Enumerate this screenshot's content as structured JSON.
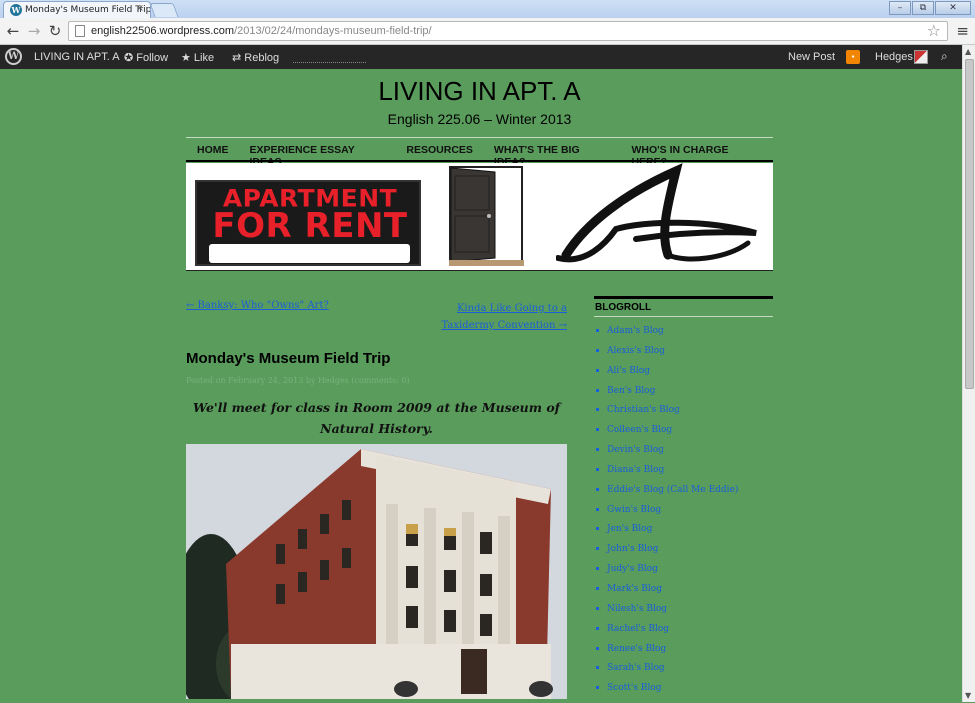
{
  "browser": {
    "tab_title": "Monday's Museum Field Trip",
    "tab_close": "×",
    "url_host": "english22506.wordpress.com",
    "url_path": "/2013/02/24/mondays-museum-field-trip/",
    "window_buttons": [
      "–",
      "⧉",
      "✕"
    ]
  },
  "adminbar": {
    "site_name": "LIVING IN APT. A",
    "follow": "Follow",
    "like": "Like",
    "reblog": "Reblog",
    "new_post": "New Post",
    "user": "Hedges"
  },
  "site": {
    "title": "LIVING IN APT. A",
    "description": "English 225.06 – Winter 2013"
  },
  "nav": [
    "HOME",
    "EXPERIENCE ESSAY IDEAS",
    "RESOURCES",
    "WHAT'S THE BIG IDEA?",
    "WHO'S IN CHARGE HERE?"
  ],
  "banner": {
    "sign_line1": "APARTMENT",
    "sign_line2": "FOR RENT"
  },
  "post_nav": {
    "prev": "← Banksy: Who \"Owns\" Art?",
    "next_line1": "Kinda Like Going to a",
    "next_line2": "Taxidermy Convention →"
  },
  "post": {
    "title": "Monday's Museum Field Trip",
    "meta": "Posted on February 24, 2013 by Hedges (comments: 0)",
    "lead": "We'll meet for class in Room 2009 at the Museum of Natural History."
  },
  "sidebar": {
    "widget_title": "BLOGROLL",
    "links": [
      "Adam's Blog",
      "Alexis's Blog",
      "Ali's Blog",
      "Ben's Blog",
      "Christian's Blog",
      "Colleen's Blog",
      "Devin's Blog",
      "Diana's Blog",
      "Eddie's Blog (Call Me Eddie)",
      "Gwin's Blog",
      "Jen's Blog",
      "John's Blog",
      "Judy's Blog",
      "Mark's Blog",
      "Nilesh's Blog",
      "Rachel's Blog",
      "Renee's Blog",
      "Sarah's Blog",
      "Scott's Blog"
    ]
  },
  "colors": {
    "page_bg": "#599c5c",
    "link": "#1a5fd9",
    "adminbar_bg": "#262626",
    "sign_red": "#e8202a"
  }
}
